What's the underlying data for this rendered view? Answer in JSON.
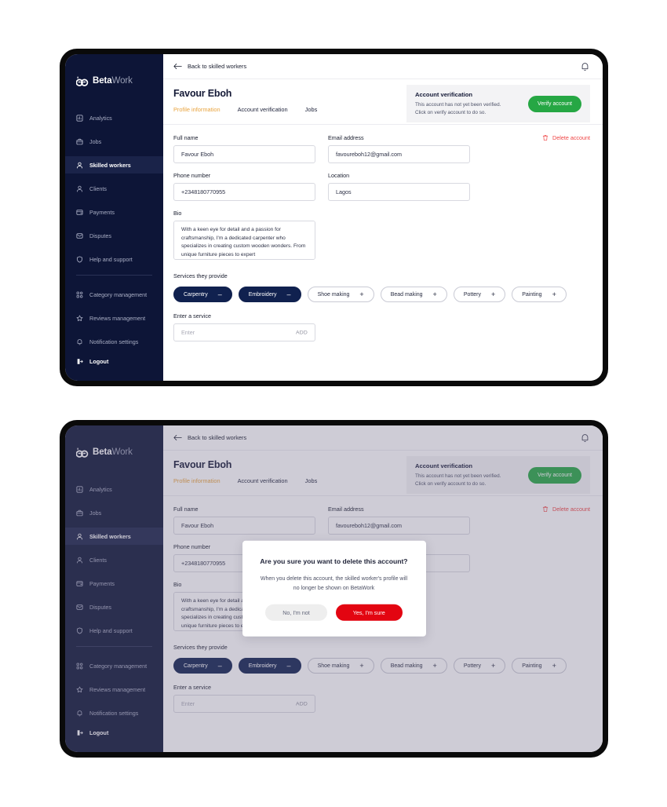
{
  "brand": {
    "name_bold": "Beta",
    "name_light": "Work",
    "logo_icon": "betawork-logo-icon"
  },
  "colors": {
    "sidebar_bg": "#0d1537",
    "accent_tab": "#e8a33d",
    "verify_green": "#26a744",
    "danger_red": "#e30511",
    "delete_red": "#ef4444",
    "chip_selected": "#10214f"
  },
  "sidebar": {
    "items": [
      {
        "label": "Analytics",
        "icon": "analytics-icon",
        "active": false
      },
      {
        "label": "Jobs",
        "icon": "briefcase-icon",
        "active": false
      },
      {
        "label": "Skilled workers",
        "icon": "user-icon",
        "active": true
      },
      {
        "label": "Clients",
        "icon": "user-icon",
        "active": false
      },
      {
        "label": "Payments",
        "icon": "card-icon",
        "active": false
      },
      {
        "label": "Disputes",
        "icon": "message-icon",
        "active": false
      },
      {
        "label": "Help and support",
        "icon": "shield-icon",
        "active": false
      }
    ],
    "items_secondary": [
      {
        "label": "Category management",
        "icon": "grid-icon"
      },
      {
        "label": "Reviews management",
        "icon": "star-icon"
      },
      {
        "label": "Notification settings",
        "icon": "bell-icon"
      }
    ],
    "logout": {
      "label": "Logout",
      "icon": "logout-icon"
    }
  },
  "topbar": {
    "back_label": "Back to skilled workers",
    "back_icon": "arrow-left-icon",
    "notification_icon": "bell-icon"
  },
  "header": {
    "title": "Favour Eboh",
    "tabs": [
      {
        "label": "Profile information",
        "active": true
      },
      {
        "label": "Account verification",
        "active": false
      },
      {
        "label": "Jobs",
        "active": false
      }
    ]
  },
  "verification": {
    "title": "Account verification",
    "line1": "This account has not yet been verified.",
    "line2": "Click on verify account to do so.",
    "button_label": "Verify account"
  },
  "form": {
    "delete_label": "Delete account",
    "delete_icon": "trash-icon",
    "full_name": {
      "label": "Full name",
      "value": "Favour Eboh"
    },
    "email": {
      "label": "Email address",
      "value": "favoureboh12@gmail.com"
    },
    "phone": {
      "label": "Phone number",
      "value": "+2348180770955"
    },
    "location": {
      "label": "Location",
      "value": "Lagos"
    },
    "bio": {
      "label": "Bio",
      "value": "With a keen eye for detail and a passion for craftsmanship, I'm a dedicated carpenter who specializes in creating custom wooden wonders. From unique furniture pieces to expert"
    }
  },
  "services": {
    "label": "Services they provide",
    "chips": [
      {
        "label": "Carpentry",
        "sign": "–",
        "selected": true
      },
      {
        "label": "Embroidery",
        "sign": "–",
        "selected": true
      },
      {
        "label": "Shoe making",
        "sign": "+",
        "selected": false
      },
      {
        "label": "Bead making",
        "sign": "+",
        "selected": false
      },
      {
        "label": "Pottery",
        "sign": "+",
        "selected": false
      },
      {
        "label": "Painting",
        "sign": "+",
        "selected": false
      }
    ],
    "add": {
      "label": "Enter a service",
      "placeholder": "Enter",
      "value": "",
      "button_label": "ADD"
    }
  },
  "modal": {
    "title": "Are you sure you want to delete this account?",
    "message": "When you delete this account, the skilled worker's profile will no longer be shown on BetaWork",
    "cancel_label": "No, I'm not",
    "confirm_label": "Yes, I'm sure"
  }
}
